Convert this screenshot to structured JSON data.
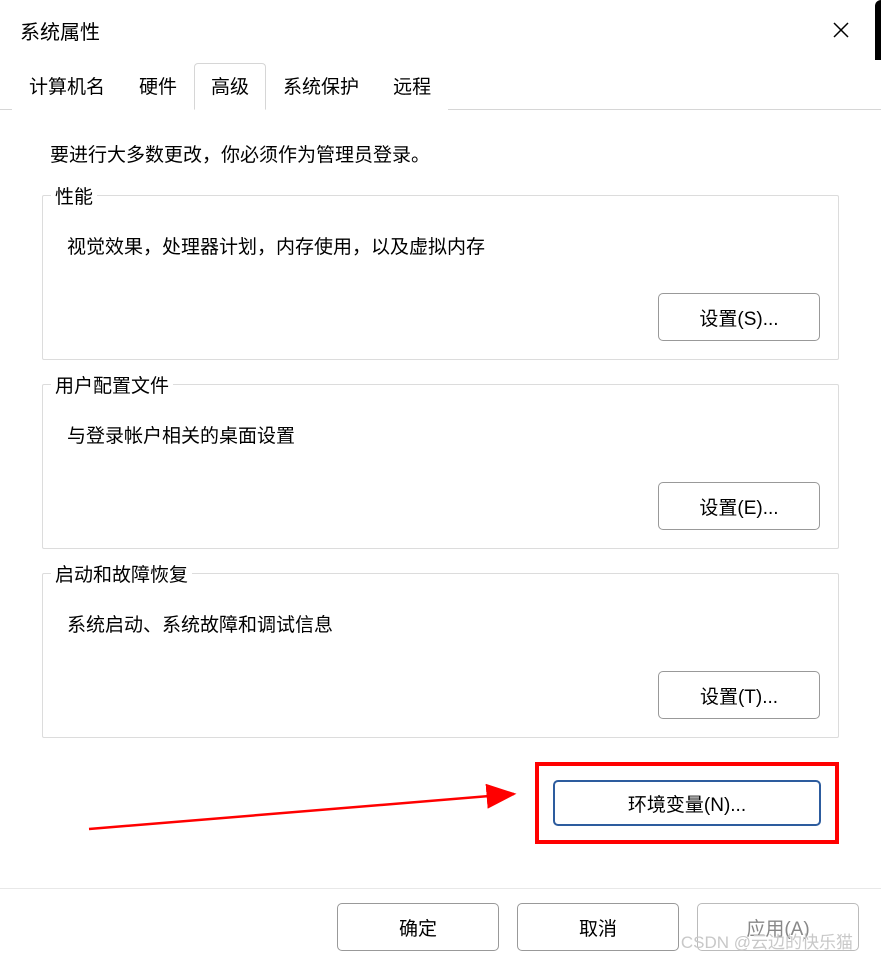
{
  "dialog": {
    "title": "系统属性",
    "tabs": [
      {
        "label": "计算机名"
      },
      {
        "label": "硬件"
      },
      {
        "label": "高级",
        "active": true
      },
      {
        "label": "系统保护"
      },
      {
        "label": "远程"
      }
    ],
    "admin_notice": "要进行大多数更改，你必须作为管理员登录。",
    "groups": {
      "performance": {
        "title": "性能",
        "desc": "视觉效果，处理器计划，内存使用，以及虚拟内存",
        "button": "设置(S)..."
      },
      "user_profile": {
        "title": "用户配置文件",
        "desc": "与登录帐户相关的桌面设置",
        "button": "设置(E)..."
      },
      "startup": {
        "title": "启动和故障恢复",
        "desc": "系统启动、系统故障和调试信息",
        "button": "设置(T)..."
      }
    },
    "env_button": "环境变量(N)...",
    "bottom": {
      "ok": "确定",
      "cancel": "取消",
      "apply": "应用(A)"
    }
  },
  "watermark": "CSDN @云边的快乐猫"
}
